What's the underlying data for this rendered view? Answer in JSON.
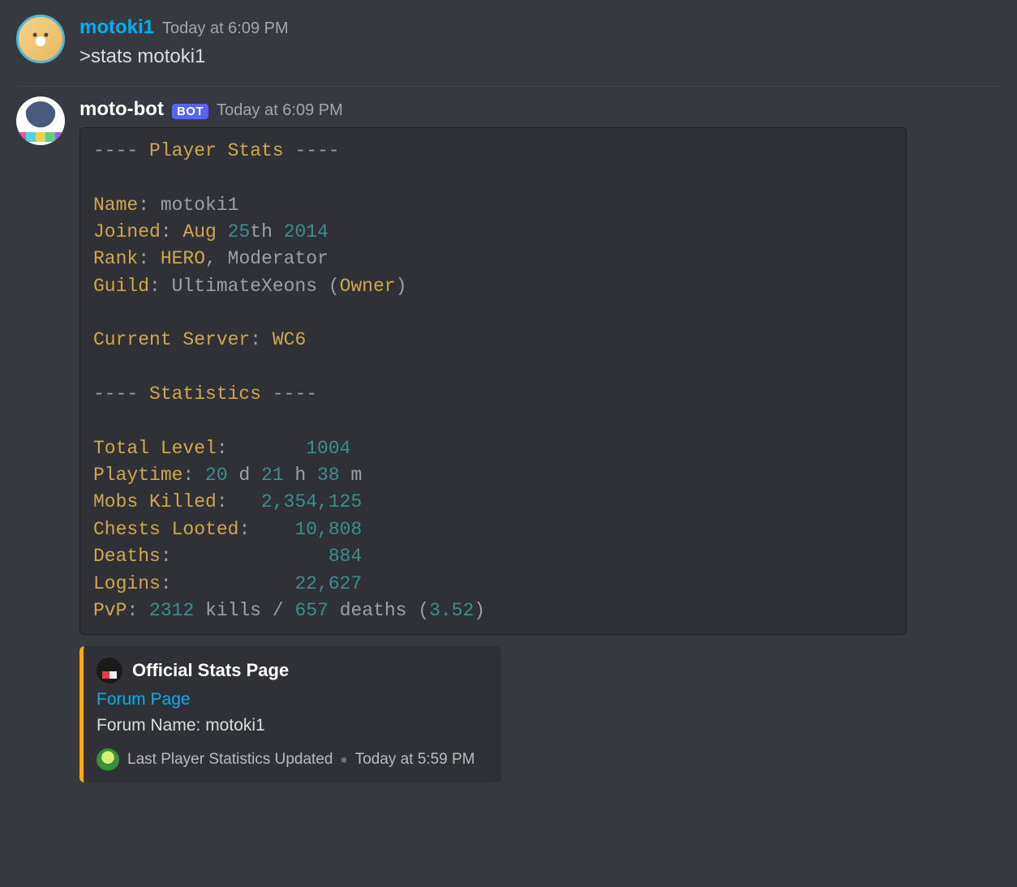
{
  "messages": {
    "user": {
      "name": "motoki1",
      "timestamp": "Today at 6:09 PM",
      "text": ">stats motoki1"
    },
    "bot": {
      "name": "moto-bot",
      "botTag": "BOT",
      "timestamp": "Today at 6:09 PM"
    }
  },
  "code": {
    "header": "---- Player Stats ----",
    "nameLabel": "Name",
    "nameVal": "motoki1",
    "joinedLabel": "Joined",
    "joinedMonth": "Aug",
    "joinedDay": "25",
    "joinedSuffix": "th",
    "joinedYear": "2014",
    "rankLabel": "Rank",
    "rankVal1": "HERO",
    "rankComma": ",",
    "rankVal2": "Moderator",
    "guildLabel": "Guild",
    "guildVal": "UltimateXeons",
    "guildRoleOpen": "(",
    "guildRole": "Owner",
    "guildRoleClose": ")",
    "serverLabel": "Current Server",
    "serverVal": "WC6",
    "statsHeader": "---- Statistics ----",
    "totalLevelLabel": "Total Level",
    "totalLevelVal": "1004",
    "playtimeLabel": "Playtime",
    "playD": "20",
    "dUnit": "d",
    "playH": "21",
    "hUnit": "h",
    "playM": "38",
    "mUnit": "m",
    "mobsLabel": "Mobs Killed",
    "mobsVal": "2,354,125",
    "chestsLabel": "Chests Looted",
    "chestsVal": "10,808",
    "deathsLabel": "Deaths",
    "deathsVal": "884",
    "loginsLabel": "Logins",
    "loginsVal": "22,627",
    "pvpLabel": "PvP",
    "pvpKills": "2312",
    "pvpKillsWord": "kills",
    "pvpSlash": "/",
    "pvpDeaths": "657",
    "pvpDeathsWord": "deaths",
    "pvpRatioOpen": "(",
    "pvpRatio": "3.52",
    "pvpRatioClose": ")"
  },
  "embed": {
    "title": "Official Stats Page",
    "link": "Forum Page",
    "desc": "Forum Name: motoki1",
    "footerText": "Last Player Statistics Updated",
    "footerTime": "Today at 5:59 PM"
  }
}
